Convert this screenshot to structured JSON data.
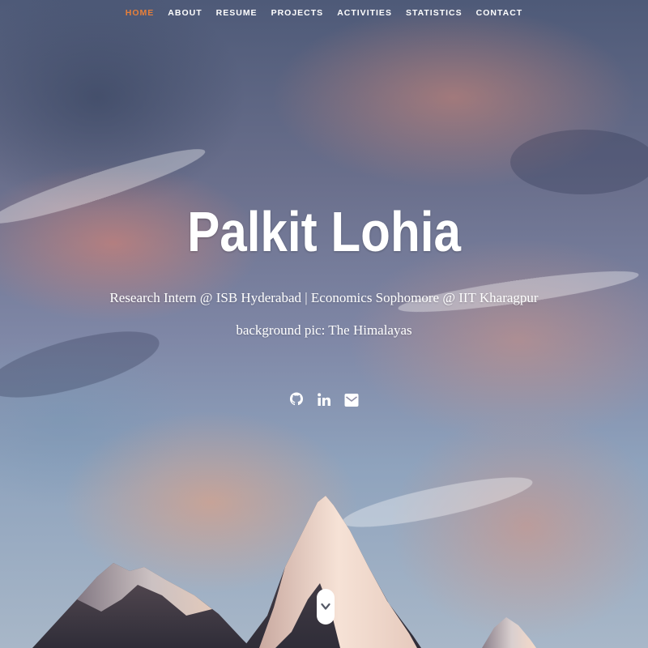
{
  "nav": {
    "items": [
      {
        "label": "HOME",
        "active": true
      },
      {
        "label": "ABOUT",
        "active": false
      },
      {
        "label": "RESUME",
        "active": false
      },
      {
        "label": "PROJECTS",
        "active": false
      },
      {
        "label": "ACTIVITIES",
        "active": false
      },
      {
        "label": "STATISTICS",
        "active": false
      },
      {
        "label": "CONTACT",
        "active": false
      }
    ],
    "active_color": "#e8803a"
  },
  "hero": {
    "title": "Palkit Lohia",
    "subtitle": "Research Intern @ ISB Hyderabad | Economics Sophomore @ IIT Kharagpur",
    "caption": "background pic: The Himalayas"
  },
  "social": {
    "icons": [
      "github-icon",
      "linkedin-icon",
      "email-icon"
    ]
  },
  "scroll": {
    "icon": "chevron-down-icon"
  }
}
